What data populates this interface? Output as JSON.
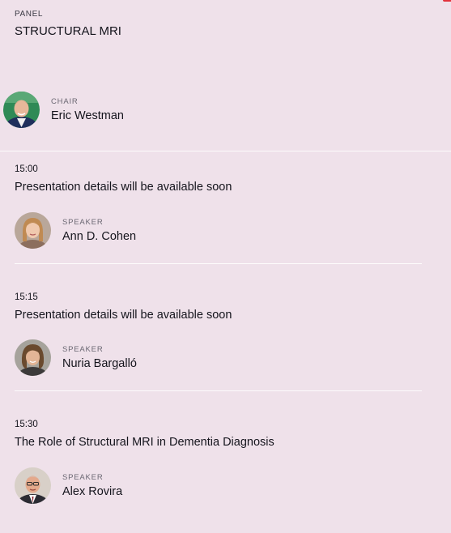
{
  "panel": {
    "eyebrow": "PANEL",
    "title": "STRUCTURAL MRI"
  },
  "chair": {
    "role": "CHAIR",
    "name": "Eric Westman",
    "avatar_icon": "chair-portrait"
  },
  "sessions": [
    {
      "time": "15:00",
      "title": "Presentation details will be available soon",
      "speaker": {
        "role": "SPEAKER",
        "name": "Ann D. Cohen",
        "avatar_icon": "speaker-portrait"
      }
    },
    {
      "time": "15:15",
      "title": "Presentation details will be available soon",
      "speaker": {
        "role": "SPEAKER",
        "name": "Nuria Bargalló",
        "avatar_icon": "speaker-portrait"
      }
    },
    {
      "time": "15:30",
      "title": "The Role of Structural MRI in Dementia Diagnosis",
      "speaker": {
        "role": "SPEAKER",
        "name": "Alex Rovira",
        "avatar_icon": "speaker-portrait"
      }
    }
  ],
  "colors": {
    "background": "#efe1ea",
    "text": "#14141c",
    "muted": "#6b6873",
    "accent": "#e2323c"
  }
}
